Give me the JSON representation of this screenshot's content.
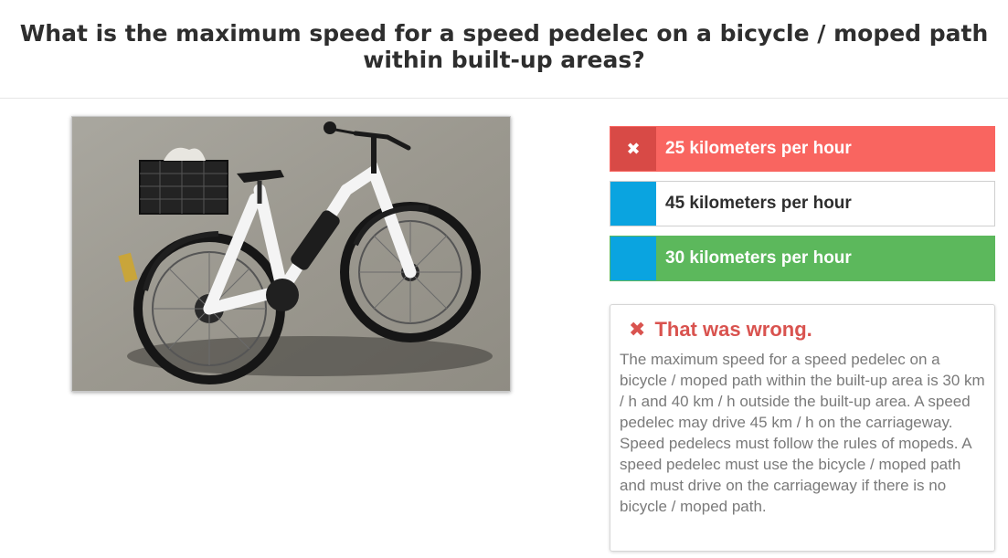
{
  "question": {
    "text": "What is the maximum speed for a speed pedelec on a bicycle / moped path within built-up areas?"
  },
  "image": {
    "subject": "bicycle-photo"
  },
  "answers": [
    {
      "label": "25 kilometers per hour",
      "state": "selected-wrong",
      "icon": "close-icon",
      "glyph": "✖"
    },
    {
      "label": "45 kilometers per hour",
      "state": "neutral",
      "icon": "",
      "glyph": ""
    },
    {
      "label": "30 kilometers per hour",
      "state": "correct",
      "icon": "",
      "glyph": ""
    }
  ],
  "feedback": {
    "icon": "close-icon",
    "glyph": "✖",
    "title": "That was wrong.",
    "text": "The maximum speed for a speed pedelec on a bicycle / moped path within the built-up area is 30 km / h and 40 km / h outside the built-up area. A speed pedelec may drive 45 km / h on the carriageway. Speed pedelecs must follow the rules of mopeds. A speed pedelec must use the bicycle / moped path and must drive on the carriageway if there is no bicycle / moped path."
  },
  "colors": {
    "wrong": "#f96560",
    "wrong_tab": "#d84a46",
    "correct": "#5cb85c",
    "neutral_tab": "#0aa4e0",
    "feedback_title": "#d9534f"
  }
}
